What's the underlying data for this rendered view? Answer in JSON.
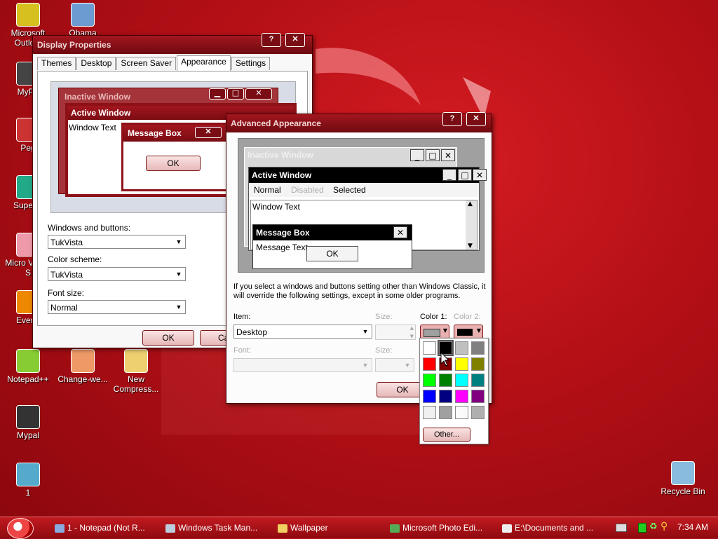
{
  "desktop": {
    "icons": [
      {
        "label": "Microsoft Outlo...",
        "icon": "outlook-icon",
        "color": "#d6c020"
      },
      {
        "label": "Obama",
        "icon": "image-file-icon",
        "color": "#6c9bd2"
      },
      {
        "label": "MyPa",
        "icon": "messenger-icon",
        "color": "#444"
      },
      {
        "label": "Peg",
        "icon": "pegasus-icon",
        "color": "#c33"
      },
      {
        "label": "Superm",
        "icon": "globe-icon",
        "color": "#2a8"
      },
      {
        "label": "Micro Visual S",
        "icon": "visual-studio-icon",
        "color": "#e9a"
      },
      {
        "label": "Everyt",
        "icon": "search-app-icon",
        "color": "#e80"
      },
      {
        "label": "Notepad++",
        "icon": "notepadpp-icon",
        "color": "#8c3"
      },
      {
        "label": "Change-we...",
        "icon": "app-icon",
        "color": "#e96"
      },
      {
        "label": "New Compress...",
        "icon": "zip-folder-icon",
        "color": "#eed070"
      },
      {
        "label": "Mypal",
        "icon": "mypal-icon",
        "color": "#333"
      },
      {
        "label": "1",
        "icon": "document-icon",
        "color": "#5ac"
      },
      {
        "label": "Recycle Bin",
        "icon": "recycle-bin-icon",
        "color": "#8bd"
      }
    ]
  },
  "display_properties": {
    "title": "Display Properties",
    "help": "?",
    "close": "✕",
    "tabs": [
      "Themes",
      "Desktop",
      "Screen Saver",
      "Appearance",
      "Settings"
    ],
    "active_tab": "Appearance",
    "preview": {
      "inactive_title": "Inactive Window",
      "active_title": "Active Window",
      "window_text": "Window Text",
      "msgbox_title": "Message Box",
      "msgbox_ok": "OK"
    },
    "windows_buttons_label": "Windows and buttons:",
    "windows_buttons_value": "TukVista",
    "color_scheme_label": "Color scheme:",
    "color_scheme_value": "TukVista",
    "font_size_label": "Font size:",
    "font_size_value": "Normal",
    "ok": "OK",
    "cancel": "Can"
  },
  "advanced_appearance": {
    "title": "Advanced Appearance",
    "help": "?",
    "close": "✕",
    "preview": {
      "inactive_title": "Inactive Window",
      "active_title": "Active Window",
      "menu_normal": "Normal",
      "menu_disabled": "Disabled",
      "menu_selected": "Selected",
      "window_text": "Window Text",
      "msgbox_title": "Message Box",
      "msgbox_text": "Message Text",
      "msgbox_ok": "OK"
    },
    "info": "If you select a windows and buttons setting other than Windows Classic, it will override the following settings, except in some older programs.",
    "item_label": "Item:",
    "item_value": "Desktop",
    "size_label": "Size:",
    "color1_label": "Color 1:",
    "color2_label": "Color 2:",
    "font_label": "Font:",
    "size2_label": "Size:",
    "ok": "OK"
  },
  "color_picker": {
    "swatches": [
      "#ffffff",
      "#000000",
      "#c0c0c0",
      "#808080",
      "#ff0000",
      "#800000",
      "#ffff00",
      "#808000",
      "#00ff00",
      "#008000",
      "#00ffff",
      "#008080",
      "#0000ff",
      "#000080",
      "#ff00ff",
      "#800080",
      "#f0f0f0",
      "#a0a0a0",
      "#fafafa",
      "#b0b0b0"
    ],
    "selected_index": 1,
    "other": "Other..."
  },
  "taskbar": {
    "tasks": [
      {
        "label": "1 - Notepad (Not R...",
        "icon": "notepad-icon",
        "color": "#8ad"
      },
      {
        "label": "Windows Task Man...",
        "icon": "task-manager-icon",
        "color": "#bcd"
      },
      {
        "label": "Wallpaper",
        "icon": "folder-icon",
        "color": "#f0d060"
      },
      {
        "label": "Microsoft Photo Edi...",
        "icon": "photo-editor-icon",
        "color": "#5a5"
      },
      {
        "label": "E:\\Documents and ...",
        "icon": "console-icon",
        "color": "#eee"
      }
    ],
    "clock": "7:34 AM"
  }
}
